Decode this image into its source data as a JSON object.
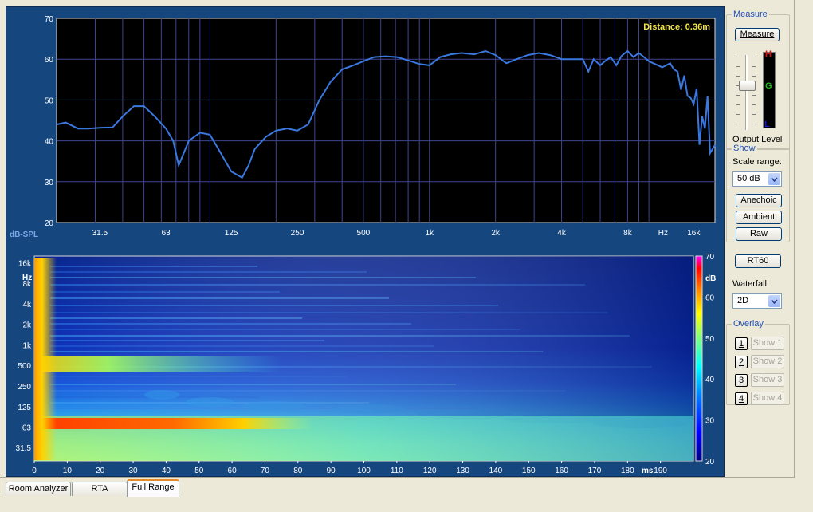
{
  "top_chart": {
    "y_ticks": [
      "70",
      "60",
      "50",
      "40",
      "30",
      "20"
    ],
    "x_ticks": [
      "31.5",
      "63",
      "125",
      "250",
      "500",
      "1k",
      "2k",
      "4k",
      "8k",
      "Hz",
      "16k"
    ],
    "y_unit_label": "dB-SPL",
    "distance_label": "Distance: 0.36m",
    "line_color": "#3a78e0"
  },
  "chart_data": [
    {
      "type": "line",
      "xscale": "log",
      "xlim": [
        20,
        20000
      ],
      "ylim": [
        20,
        70
      ],
      "ylabel": "dB-SPL",
      "grid": true,
      "x": [
        20,
        22,
        25,
        28,
        31.5,
        36,
        40,
        45,
        50,
        56,
        63,
        68,
        72,
        80,
        90,
        100,
        112,
        125,
        140,
        150,
        160,
        180,
        200,
        225,
        250,
        280,
        315,
        355,
        400,
        450,
        500,
        560,
        630,
        710,
        800,
        900,
        1000,
        1120,
        1250,
        1400,
        1600,
        1800,
        2000,
        2240,
        2500,
        2800,
        3150,
        3550,
        4000,
        4500,
        5000,
        5300,
        5600,
        6000,
        6300,
        6700,
        7100,
        7500,
        8000,
        8500,
        9000,
        9500,
        10000,
        11000,
        11500,
        12000,
        12500,
        13000,
        13500,
        14000,
        14500,
        15000,
        15500,
        16000,
        16500,
        17000,
        17500,
        18000,
        18500,
        19000,
        20000
      ],
      "series": [
        {
          "values": [
            44,
            44.5,
            43,
            43,
            43.2,
            43.3,
            46,
            48.5,
            48.5,
            46,
            43,
            40,
            34,
            40,
            42,
            41.5,
            37,
            32.5,
            31,
            34,
            38,
            41,
            42.5,
            43,
            42.5,
            44,
            50,
            54.5,
            57.5,
            58.5,
            59.5,
            60.5,
            60.7,
            60.5,
            59.7,
            58.8,
            58.5,
            60.5,
            61.2,
            61.5,
            61.2,
            62,
            61,
            59,
            60,
            61,
            61.5,
            61,
            60,
            60,
            60,
            57,
            60,
            58.5,
            59.5,
            60.5,
            58.5,
            60.8,
            62,
            60.5,
            61.5,
            60.5,
            59.5,
            58.5,
            58,
            58.5,
            59,
            57.5,
            57,
            52.5,
            56,
            51,
            50.5,
            49,
            52.8,
            39,
            46,
            43,
            51,
            37,
            39
          ]
        }
      ]
    },
    {
      "type": "heatmap",
      "x_ticks": [
        "0",
        "10",
        "20",
        "30",
        "40",
        "50",
        "60",
        "70",
        "80",
        "90",
        "100",
        "110",
        "120",
        "130",
        "140",
        "150",
        "160",
        "170",
        "180",
        "190"
      ],
      "x_unit": "ms",
      "xlim": [
        0,
        200
      ],
      "y_ticks": [
        "16k",
        "8k",
        "4k",
        "2k",
        "1k",
        "500",
        "250",
        "125",
        "63",
        "31.5"
      ],
      "y_unit": "Hz",
      "colorbar_ticks": [
        "70",
        "60",
        "50",
        "40",
        "30",
        "20"
      ],
      "colorbar_unit": "dB",
      "zlim": [
        20,
        70
      ]
    }
  ],
  "controls": {
    "measure_group": {
      "title": "Measure",
      "button": "Measure",
      "output_level": "Output Level",
      "meter_h": "H",
      "meter_g": "G",
      "meter_l": "L"
    },
    "show_group": {
      "title": "Show",
      "scale_range_label": "Scale range:",
      "scale_range_value": "50 dB",
      "anechoic": "Anechoic",
      "ambient": "Ambient",
      "raw": "Raw"
    },
    "rt60": "RT60",
    "waterfall_label": "Waterfall:",
    "waterfall_value": "2D",
    "overlay_group": {
      "title": "Overlay",
      "items": [
        {
          "num": "1",
          "label": "Show 1"
        },
        {
          "num": "2",
          "label": "Show 2"
        },
        {
          "num": "3",
          "label": "Show 3"
        },
        {
          "num": "4",
          "label": "Show 4"
        }
      ]
    }
  },
  "tabs": [
    "Room Analyzer",
    "RTA",
    "Full Range"
  ],
  "active_tab": "Full Range"
}
